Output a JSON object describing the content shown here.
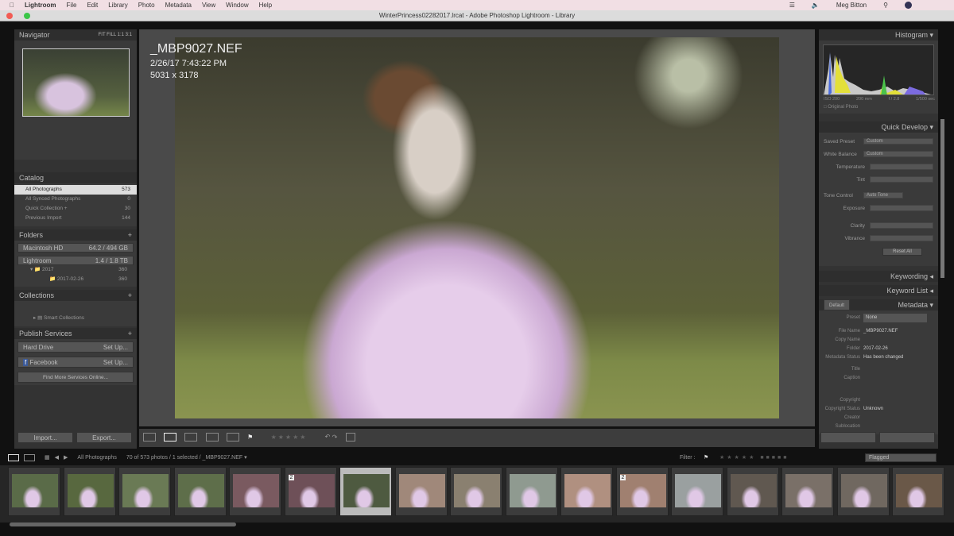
{
  "menubar": {
    "app": "Lightroom",
    "items": [
      "File",
      "Edit",
      "Library",
      "Photo",
      "Metadata",
      "View",
      "Window",
      "Help"
    ],
    "user": "Meg Bitton"
  },
  "window": {
    "title": "WinterPrincess02282017.lrcat - Adobe Photoshop Lightroom - Library"
  },
  "navigator": {
    "title": "Navigator",
    "zoom_options": [
      "FIT",
      "FILL",
      "1:1",
      "3:1"
    ]
  },
  "catalog": {
    "title": "Catalog",
    "items": [
      {
        "label": "All Photographs",
        "count": "573"
      },
      {
        "label": "All Synced Photographs",
        "count": "0"
      },
      {
        "label": "Quick Collection +",
        "count": "30"
      },
      {
        "label": "Previous Import",
        "count": "144"
      }
    ]
  },
  "folders": {
    "title": "Folders",
    "volumes": [
      {
        "label": "Macintosh HD",
        "info": "64.2 / 494 GB"
      },
      {
        "label": "Lightroom",
        "info": "1.4 / 1.8 TB"
      }
    ],
    "items": [
      {
        "label": "2017",
        "count": "360"
      },
      {
        "label": "2017-02-26",
        "count": "360"
      }
    ]
  },
  "collections": {
    "title": "Collections",
    "items": [
      "Smart Collections"
    ]
  },
  "publish": {
    "title": "Publish Services",
    "items": [
      {
        "label": "Hard Drive",
        "action": "Set Up..."
      },
      {
        "label": "Facebook",
        "action": "Set Up..."
      }
    ],
    "find_more": "Find More Services Online..."
  },
  "buttons": {
    "import": "Import...",
    "export": "Export..."
  },
  "photo": {
    "filename": "_MBP9027.NEF",
    "datetime": "2/26/17 7:43:22 PM",
    "dimensions": "5031 x 3178"
  },
  "histogram": {
    "title": "Histogram",
    "iso": "ISO 200",
    "focal": "200 mm",
    "aperture": "f / 2.8",
    "shutter": "1/500 sec",
    "original_photo": "Original Photo"
  },
  "quick_develop": {
    "title": "Quick Develop",
    "saved_preset_label": "Saved Preset",
    "saved_preset": "Custom",
    "white_balance_label": "White Balance",
    "white_balance": "Custom",
    "temperature": "Temperature",
    "tint": "Tint",
    "tone_control": "Tone Control",
    "auto_tone": "Auto Tone",
    "exposure": "Exposure",
    "clarity": "Clarity",
    "vibrance": "Vibrance",
    "reset": "Reset All"
  },
  "keywording": {
    "title": "Keywording"
  },
  "keyword_list": {
    "title": "Keyword List"
  },
  "metadata": {
    "title": "Metadata",
    "preset_select": "Default",
    "preset_label": "Preset",
    "preset": "None",
    "fields": [
      {
        "label": "File Name",
        "value": "_MBP9027.NEF"
      },
      {
        "label": "Copy Name",
        "value": ""
      },
      {
        "label": "Folder",
        "value": "2017-02-26"
      },
      {
        "label": "Metadata Status",
        "value": "Has been changed"
      },
      {
        "label": "Title",
        "value": ""
      },
      {
        "label": "Caption",
        "value": ""
      },
      {
        "label": "Copyright",
        "value": ""
      },
      {
        "label": "Copyright Status",
        "value": "Unknown"
      },
      {
        "label": "Creator",
        "value": ""
      },
      {
        "label": "Sublocation",
        "value": ""
      }
    ]
  },
  "filmstrip": {
    "source": "All Photographs",
    "status": "70 of 573 photos / 1 selected / _MBP9027.NEF",
    "filter_label": "Filter :",
    "filter_value": "Flagged",
    "badges": [
      "2",
      "2"
    ]
  }
}
